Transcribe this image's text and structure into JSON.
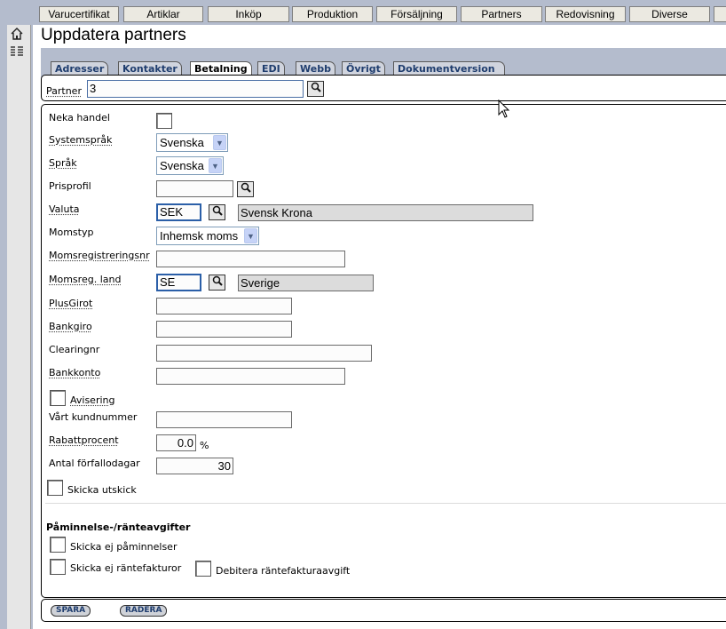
{
  "top_menu": [
    "Varucertifikat",
    "Artiklar",
    "Inköp",
    "Produktion",
    "Försäljning",
    "Partners",
    "Redovisning",
    "Diverse"
  ],
  "left_toolbar": {
    "home_icon": "home-icon",
    "list_icon": "list-icon"
  },
  "page_title": "Uppdatera partners",
  "tabs": [
    "Adresser",
    "Kontakter",
    "Betalning",
    "EDI",
    "Webb",
    "Övrigt",
    "Dokumentversion"
  ],
  "active_tab": "Betalning",
  "partner": {
    "label": "Partner",
    "value": "3"
  },
  "form": {
    "neka_handel": "Neka handel",
    "systemsprak": {
      "label": "Systemspråk",
      "value": "Svenska"
    },
    "sprak": {
      "label": "Språk",
      "value": "Svenska"
    },
    "prisprofil": {
      "label": "Prisprofil",
      "value": ""
    },
    "valuta": {
      "label": "Valuta",
      "code": "SEK",
      "name": "Svensk Krona"
    },
    "momstyp": {
      "label": "Momstyp",
      "value": "Inhemsk moms"
    },
    "momsregistreringsnr": {
      "label": "Momsregistreringsnr",
      "value": ""
    },
    "momsreg_land": {
      "label": "Momsreg. land",
      "code": "SE",
      "name": "Sverige"
    },
    "plusgirot": {
      "label": "PlusGirot",
      "value": ""
    },
    "bankgiro": {
      "label": "Bankgiro",
      "value": ""
    },
    "clearingnr": {
      "label": "Clearingnr",
      "value": ""
    },
    "bankkonto": {
      "label": "Bankkonto",
      "value": ""
    },
    "avisering": "Avisering",
    "vart_kundnummer": {
      "label": "Vårt kundnummer",
      "value": ""
    },
    "rabattprocent": {
      "label": "Rabattprocent",
      "value": "0.0",
      "unit": "%"
    },
    "antal_forfallodagar": {
      "label": "Antal förfallodagar",
      "value": "30"
    },
    "skicka_utskick": "Skicka utskick"
  },
  "reminders": {
    "heading": "Påminnelse-/ränteavgifter",
    "skicka_ej_paminnelser": "Skicka ej påminnelser",
    "skicka_ej_rantefakturor": "Skicka ej räntefakturor",
    "debitera_rantefakturaavgift": "Debitera räntefakturaavgift"
  },
  "buttons": {
    "save": "SPARA",
    "delete": "RADERA"
  },
  "colors": {
    "background": "#b4bccd",
    "tab_text": "#1f3d6e",
    "panel": "#ffffff"
  }
}
